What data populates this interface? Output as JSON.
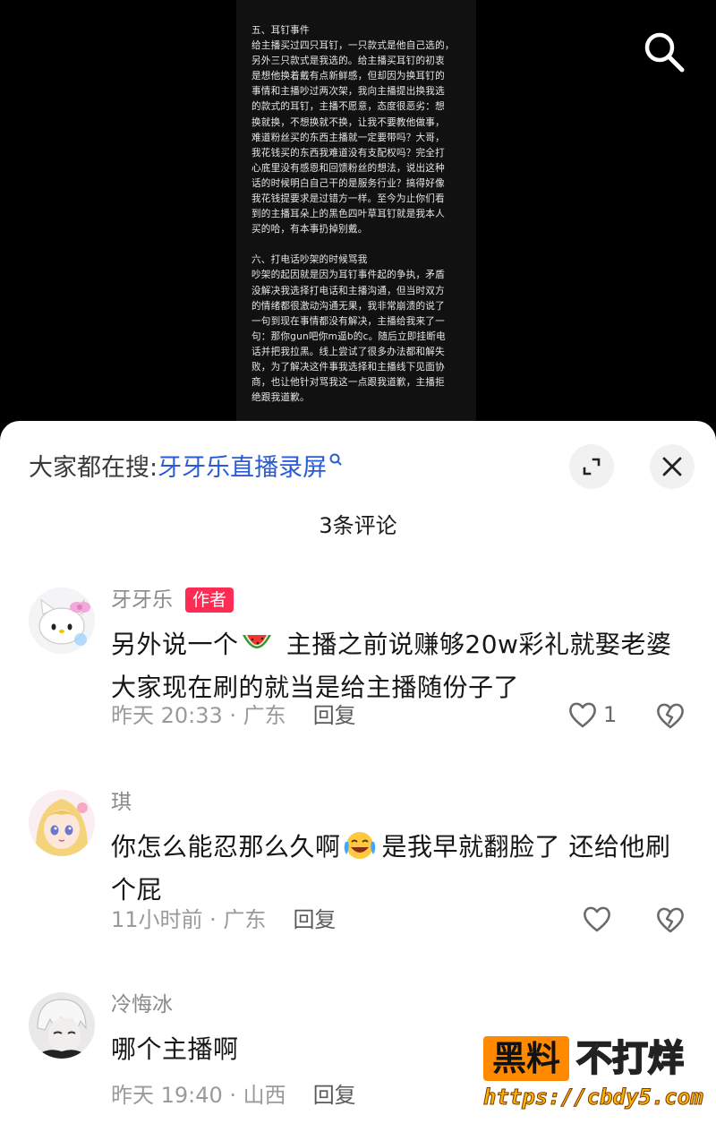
{
  "video": {
    "doc_lines_1": [
      "五、耳钉事件",
      "给主播买过四只耳钉，一只款式是他自己选的，",
      "另外三只款式是我选的。给主播买耳钉的初衷",
      "是想他换着戴有点新鲜感，但却因为换耳钉的",
      "事情和主播吵过两次架，我向主播提出换我选",
      "的款式的耳钉，主播不愿意，态度很恶劣：想",
      "换就换，不想换就不换，让我不要教他做事，",
      "难道粉丝买的东西主播就一定要带吗？大哥，",
      "我花钱买的东西我难道没有支配权吗？完全打",
      "心底里没有感恩和回馈粉丝的想法，说出这种",
      "话的时候明白自己干的是服务行业？搞得好像",
      "我花钱提要求是过错方一样。至今为止你们看",
      "到的主播耳朵上的黑色四叶草耳钉就是我本人",
      "买的哈，有本事扔掉别戴。"
    ],
    "doc_lines_2": [
      "六、打电话吵架的时候骂我",
      "吵架的起因就是因为耳钉事件起的争执，矛盾",
      "没解决我选择打电话和主播沟通，但当时双方",
      "的情绪都很激动沟通无果，我非常崩溃的说了",
      "一句到现在事情都没有解决，主播给我来了一",
      "句：那你gun吧你m逼b的c。随后立即挂断电",
      "话并把我拉黑。线上尝试了很多办法都和解失",
      "败，为了解决这件事我选择和主播线下见面协",
      "商，也让他针对骂我这一点跟我道歉，主播拒",
      "绝跟我道歉。"
    ]
  },
  "sheet": {
    "search_prefix": "大家都在搜:",
    "search_keyword": "牙牙乐直播录屏",
    "comment_count": "3条评论"
  },
  "comments": [
    {
      "username": "牙牙乐",
      "tag": "作者",
      "text_a": "另外说一个",
      "text_b": " 主播之前说赚够20w彩礼就娶老婆 大家现在刷的就当是给主播随份子了",
      "time": "昨天 20:33 · 广东",
      "reply": "回复",
      "likes": "1"
    },
    {
      "username": "琪",
      "text_a": "你怎么能忍那么久啊",
      "text_b": "是我早就翻脸了 还给他刷个屁",
      "time": "11小时前 · 广东",
      "reply": "回复",
      "likes": ""
    },
    {
      "username": "冷悔冰",
      "text_a": "哪个主播啊",
      "time": "昨天 19:40 · 山西",
      "reply": "回复"
    }
  ],
  "watermark": {
    "box": "黑料",
    "right": "不打烊",
    "url": "https://cbdy5.com"
  },
  "colors": {
    "accent_red": "#fe2c55",
    "link_blue": "#2a5bd7",
    "watermark_orange": "#ff8a00"
  },
  "icons": [
    "search-icon",
    "expand-icon",
    "close-icon",
    "heart-icon",
    "broken-heart-icon",
    "watermelon-emoji",
    "laughing-crying-emoji"
  ]
}
